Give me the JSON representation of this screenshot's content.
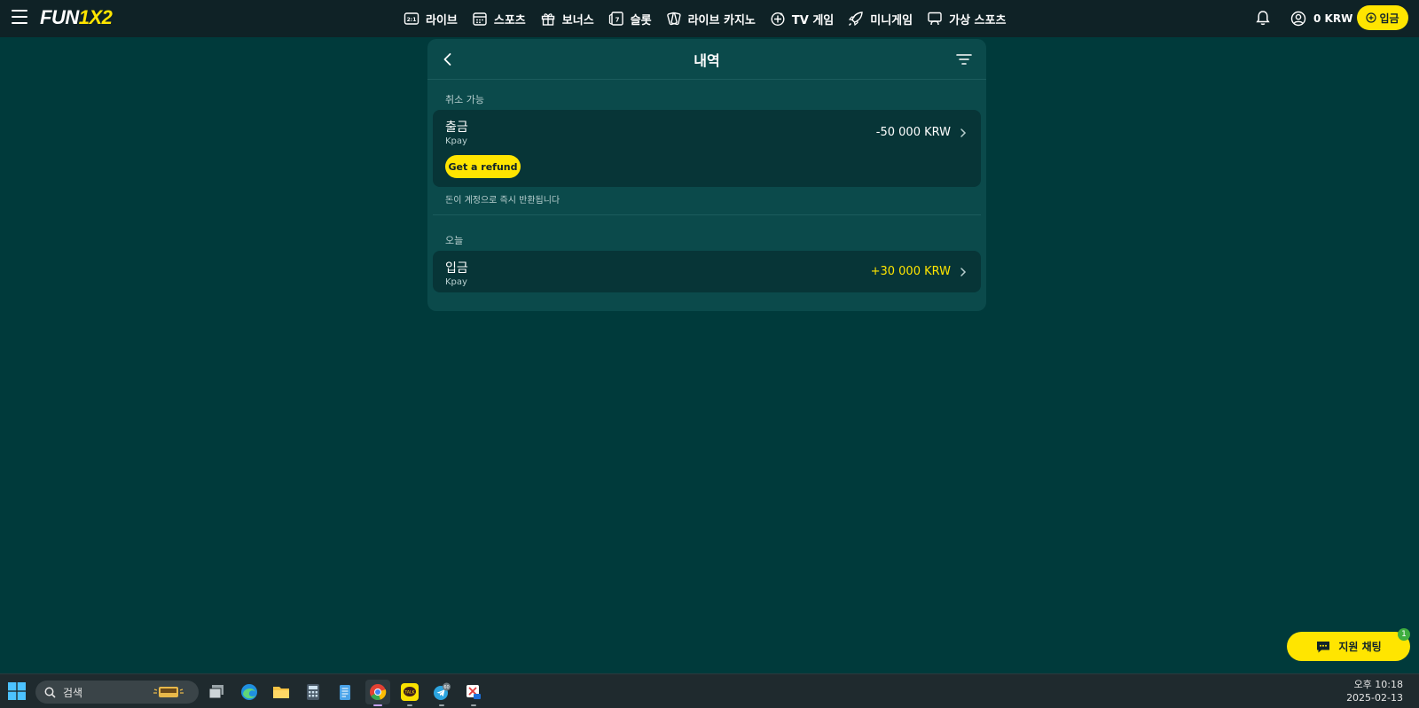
{
  "header": {
    "logo_text_a": "FUN",
    "logo_text_b": "1X2",
    "nav": [
      {
        "label": "라이브",
        "icon": "live-scoreboard-icon"
      },
      {
        "label": "스포츠",
        "icon": "calendar-icon"
      },
      {
        "label": "보너스",
        "icon": "gift-icon"
      },
      {
        "label": "슬롯",
        "icon": "slot-machine-icon"
      },
      {
        "label": "라이브 카지노",
        "icon": "cards-icon"
      },
      {
        "label": "TV 게임",
        "icon": "tv-game-icon"
      },
      {
        "label": "미니게임",
        "icon": "rocket-icon"
      },
      {
        "label": "가상 스포츠",
        "icon": "virtual-sports-icon"
      }
    ],
    "balance": "0 KRW",
    "deposit_label": "입금"
  },
  "panel": {
    "title": "내역",
    "cancellable_label": "취소 가능",
    "withdrawal": {
      "title": "출금",
      "method": "Kpay",
      "amount": "-50 000 KRW",
      "refund_label": "Get a refund"
    },
    "refund_note": "돈이 계정으로 즉시 반환됩니다",
    "today_label": "오늘",
    "deposit": {
      "title": "입금",
      "method": "Kpay",
      "amount": "+30 000 KRW"
    }
  },
  "support": {
    "label": "지원 채팅",
    "badge": "1"
  },
  "taskbar": {
    "search_placeholder": "검색",
    "telegram_badge": "60",
    "time": "오후 10:18",
    "date": "2025-02-13"
  },
  "colors": {
    "background": "#003a3b",
    "panel": "#0b4a4b",
    "accent": "#ffe500",
    "positive_amount": "#ffe500"
  }
}
